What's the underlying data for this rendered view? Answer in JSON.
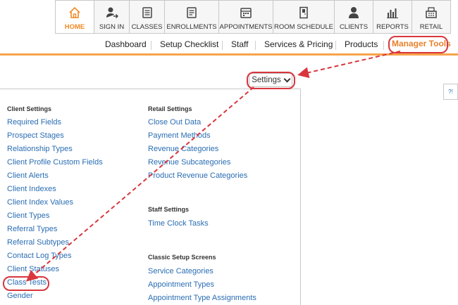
{
  "topnav": {
    "tabs": [
      {
        "label": "HOME",
        "icon": "home-icon",
        "active": true
      },
      {
        "label": "SIGN IN",
        "icon": "sign-in-icon",
        "active": false
      },
      {
        "label": "CLASSES",
        "icon": "classes-icon",
        "active": false
      },
      {
        "label": "ENROLLMENTS",
        "icon": "enrollments-icon",
        "active": false
      },
      {
        "label": "APPOINTMENTS",
        "icon": "appointments-icon",
        "active": false
      },
      {
        "label": "ROOM SCHEDULE",
        "icon": "room-schedule-icon",
        "active": false
      },
      {
        "label": "CLIENTS",
        "icon": "clients-icon",
        "active": false
      },
      {
        "label": "REPORTS",
        "icon": "reports-icon",
        "active": false
      },
      {
        "label": "RETAIL",
        "icon": "retail-icon",
        "active": false
      }
    ]
  },
  "subnav": {
    "items": [
      "Dashboard",
      "Setup Checklist",
      "Staff",
      "Services & Pricing",
      "Products",
      "Manager Tools"
    ]
  },
  "settings_button": {
    "label": "Settings"
  },
  "help": {
    "label": "?!"
  },
  "client_settings": {
    "header": "Client Settings",
    "links": [
      "Required Fields",
      "Prospect Stages",
      "Relationship Types",
      "Client Profile Custom Fields",
      "Client Alerts",
      "Client Indexes",
      "Client Index Values",
      "Client Types",
      "Referral Types",
      "Referral Subtypes",
      "Contact Log Types",
      "Client Statuses",
      "Class Tests",
      "Gender"
    ]
  },
  "retail_settings": {
    "header": "Retail Settings",
    "links": [
      "Close Out Data",
      "Payment Methods",
      "Revenue Categories",
      "Revenue Subcategories",
      "Product Revenue Categories"
    ]
  },
  "staff_settings": {
    "header": "Staff Settings",
    "links": [
      "Time Clock Tasks"
    ]
  },
  "classic_setup": {
    "header": "Classic Setup Screens",
    "links": [
      "Service Categories",
      "Appointment Types",
      "Appointment Type Assignments"
    ]
  },
  "colors": {
    "accent": "#f08a24",
    "link": "#2a6db3",
    "annotation": "#d9363e"
  }
}
